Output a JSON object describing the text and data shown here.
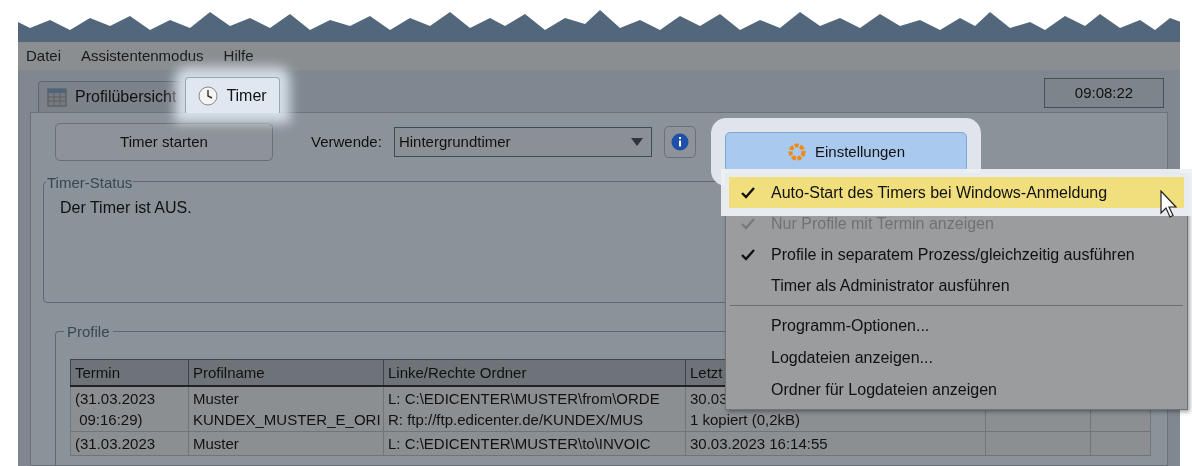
{
  "menu_bar": [
    "Datei",
    "Assistentenmodus",
    "Hilfe"
  ],
  "tabs": [
    {
      "label": "Profilübersicht",
      "selected": false
    },
    {
      "label": "Timer",
      "selected": true
    }
  ],
  "clock": "09:08:22",
  "toolbar": {
    "start_button": "Timer starten",
    "use_label": "Verwende:",
    "use_value": "Hintergrundtimer",
    "settings_button": "Einstellungen"
  },
  "timer_status": {
    "title": "Timer-Status",
    "text": "Der Timer ist AUS."
  },
  "profiles": {
    "title": "Profile",
    "columns": [
      "Termin",
      "Profilname",
      "Linke/Rechte Ordner",
      "Letzt"
    ],
    "rows": [
      [
        "(31.03.2023\n 09:16:29)",
        "Muster\nKUNDEX_MUSTER_E_ORI",
        "L: C:\\EDICENTER\\MUSTER\\from\\ORDE\nR: ftp://ftp.edicenter.de/KUNDEX/MUS",
        "30.03\n1 kopiert (0,2kB)"
      ],
      [
        "(31.03.2023",
        "Muster",
        "L: C:\\EDICENTER\\MUSTER\\to\\INVOIC",
        "30.03.2023 16:14:55"
      ]
    ]
  },
  "settings_menu": {
    "toggles": [
      {
        "label": "Auto-Start des Timers bei Windows-Anmeldung",
        "checked": true,
        "disabled": false,
        "selected": true
      },
      {
        "label": "Nur Profile mit Termin anzeigen",
        "checked": true,
        "disabled": true,
        "selected": false
      },
      {
        "label": "Profile in separatem Prozess/gleichzeitig ausführen",
        "checked": true,
        "disabled": false,
        "selected": false
      },
      {
        "label": "Timer als Administrator ausführen",
        "checked": false,
        "disabled": false,
        "selected": false
      }
    ],
    "commands": [
      {
        "label": "Programm-Optionen...",
        "selected": false
      },
      {
        "label": "Logdateien anzeigen...",
        "selected": false
      },
      {
        "label": "Ordner für Logdateien anzeigen",
        "selected": false
      }
    ]
  }
}
